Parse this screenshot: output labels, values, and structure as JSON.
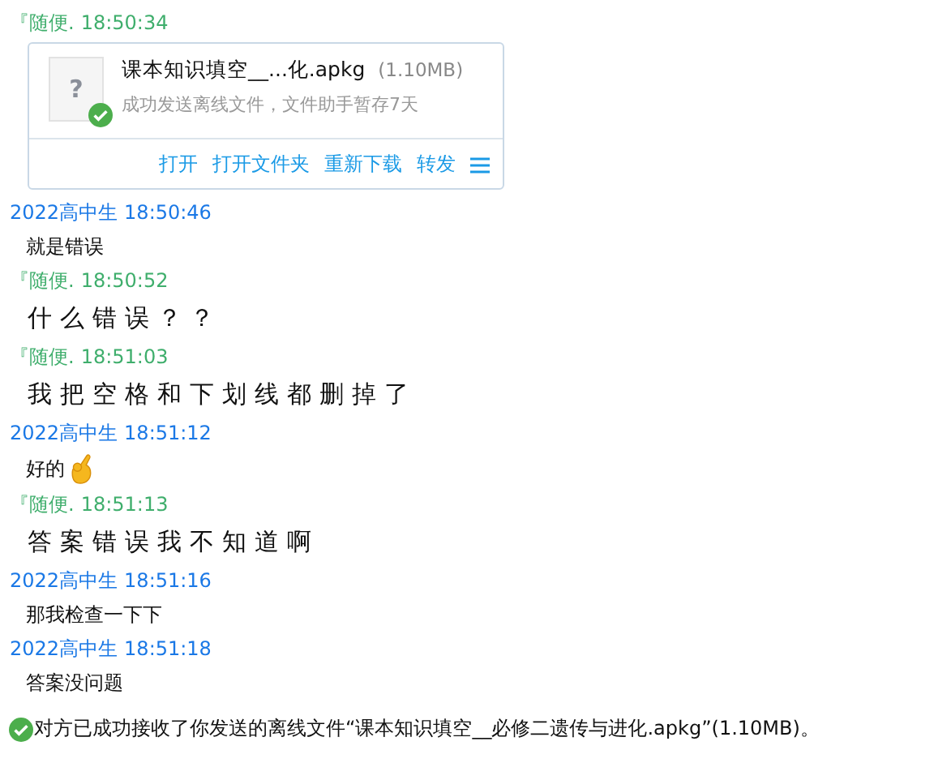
{
  "messages": [
    {
      "sender": "『随便.",
      "time": "18:50:34",
      "color": "#3fae6c",
      "kind": "file",
      "file": {
        "icon_text": "?",
        "name": "课本知识填空__...化.apkg",
        "size": "(1.10MB)",
        "status": "成功发送离线文件，文件助手暂存7天",
        "sent": true,
        "actions": [
          "打开",
          "打开文件夹",
          "重新下载",
          "转发"
        ]
      }
    },
    {
      "sender": "2022高中生",
      "time": "18:50:46",
      "color": "#1a78e6",
      "kind": "text",
      "text": "就是错误"
    },
    {
      "sender": "『随便.",
      "time": "18:50:52",
      "color": "#3fae6c",
      "kind": "handwriting",
      "text": "什么错误？？"
    },
    {
      "sender": "『随便.",
      "time": "18:51:03",
      "color": "#3fae6c",
      "kind": "handwriting",
      "text": "我把空格和下划线都删掉了"
    },
    {
      "sender": "2022高中生",
      "time": "18:51:12",
      "color": "#1a78e6",
      "kind": "text",
      "text": "好的",
      "emoji": true
    },
    {
      "sender": "『随便.",
      "time": "18:51:13",
      "color": "#3fae6c",
      "kind": "handwriting",
      "text": "答案错误我不知道啊"
    },
    {
      "sender": "2022高中生",
      "time": "18:51:16",
      "color": "#1a78e6",
      "kind": "text",
      "text": "那我检查一下下"
    },
    {
      "sender": "2022高中生",
      "time": "18:51:18",
      "color": "#1a78e6",
      "kind": "text",
      "text": "答案没问题"
    }
  ],
  "system_notice": {
    "text": "对方已成功接收了你发送的离线文件“课本知识填空__必修二遗传与进化.apkg”(1.10MB)。",
    "success": true
  }
}
